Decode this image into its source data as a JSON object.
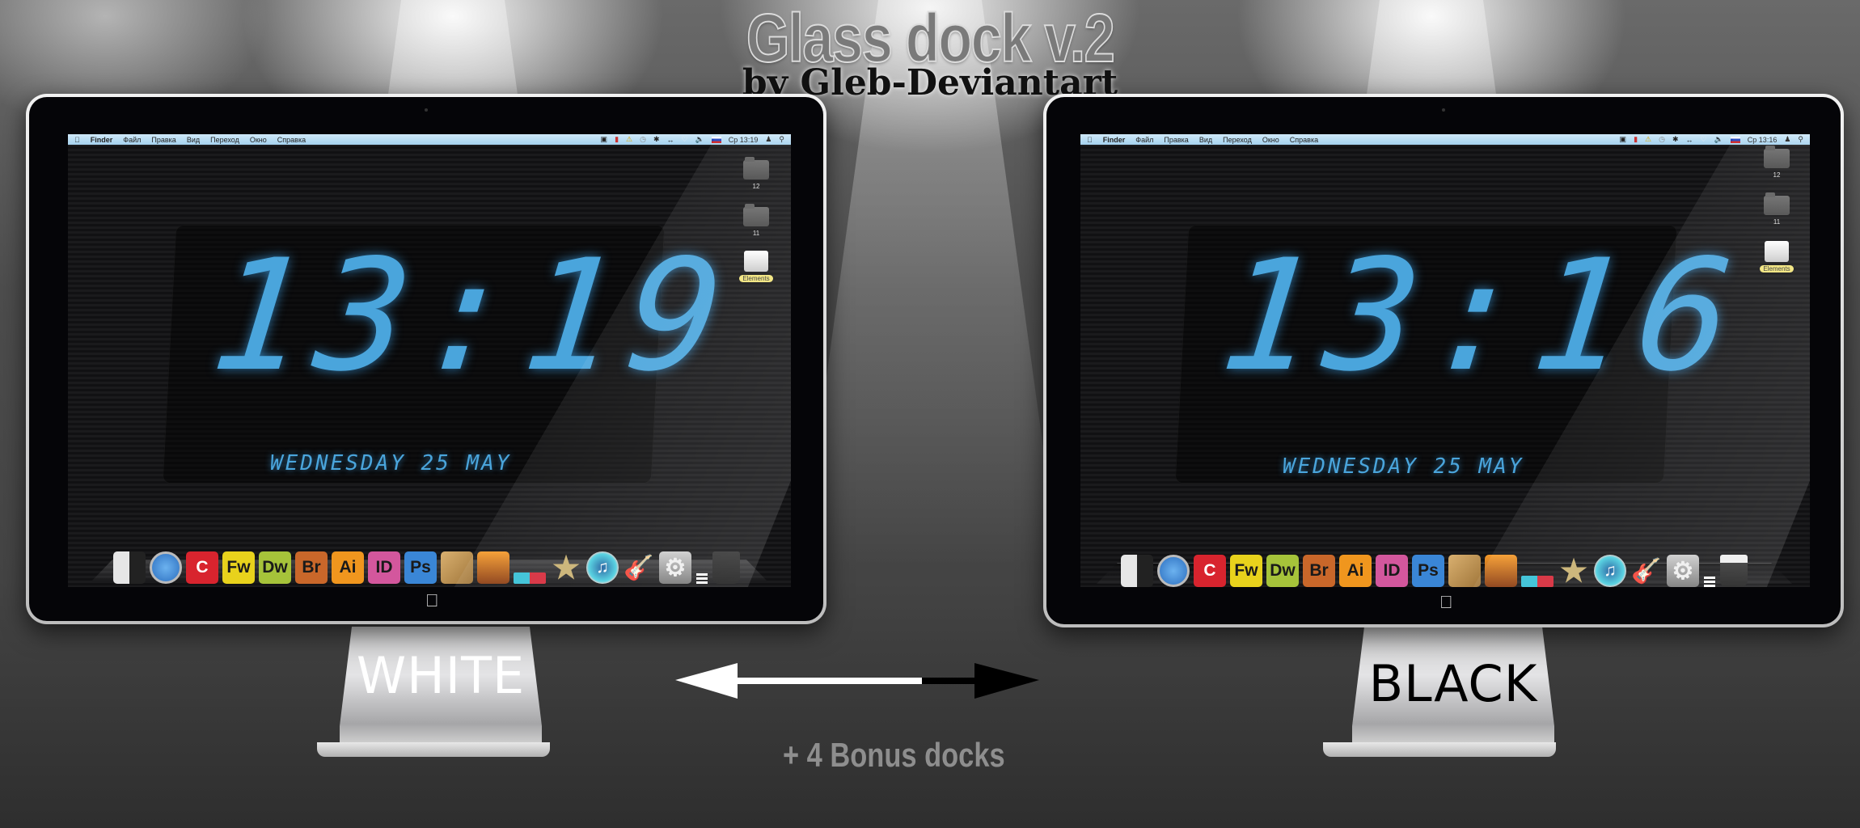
{
  "header": {
    "title": "Glass dock v.2",
    "subtitle": "by Gleb-Deviantart"
  },
  "monitors": [
    {
      "variant_label": "WHITE",
      "menubar": {
        "apple_icon": "apple-icon",
        "items": [
          "Finder",
          "Файл",
          "Правка",
          "Вид",
          "Переход",
          "Окно",
          "Справка"
        ],
        "status_icons": [
          "screen-icon",
          "battery-bars-icon",
          "warning-icon",
          "time-machine-icon",
          "bluetooth-icon",
          "sync-icon",
          "wifi-icon",
          "volume-icon",
          "russian-flag-icon"
        ],
        "clock": "Ср 13:19",
        "user_icon": "user-icon",
        "search_icon": "spotlight-icon"
      },
      "clock_widget": {
        "time": "13:19",
        "date": "WEDNESDAY 25 MAY"
      },
      "desktop_items": [
        {
          "icon": "folder-icon",
          "label": "12"
        },
        {
          "icon": "folder-icon",
          "label": "11"
        },
        {
          "icon": "external-drive-icon",
          "label": "Elements"
        }
      ],
      "dock": [
        "Finder",
        "Safari",
        "Coda",
        "Fw",
        "Dw",
        "Br",
        "Ai",
        "ID",
        "Ps",
        "Pixelmator",
        "iPhoto",
        "3D glasses",
        "iMovie",
        "iTunes",
        "GarageBand",
        "System Preferences",
        "Stack",
        "Trash"
      ],
      "trash_state": "empty"
    },
    {
      "variant_label": "BLACK",
      "menubar": {
        "apple_icon": "apple-icon",
        "items": [
          "Finder",
          "Файл",
          "Правка",
          "Вид",
          "Переход",
          "Окно",
          "Справка"
        ],
        "status_icons": [
          "screen-icon",
          "battery-bars-icon",
          "warning-icon",
          "time-machine-icon",
          "bluetooth-icon",
          "sync-icon",
          "wifi-icon",
          "volume-icon",
          "russian-flag-icon"
        ],
        "clock": "Ср 13:16",
        "user_icon": "user-icon",
        "search_icon": "spotlight-icon"
      },
      "clock_widget": {
        "time": "13:16",
        "date": "WEDNESDAY 25 MAY"
      },
      "desktop_items": [
        {
          "icon": "folder-icon",
          "label": "12"
        },
        {
          "icon": "folder-icon",
          "label": "11"
        },
        {
          "icon": "external-drive-icon",
          "label": "Elements"
        }
      ],
      "dock": [
        "Finder",
        "Safari",
        "Coda",
        "Fw",
        "Dw",
        "Br",
        "Ai",
        "ID",
        "Ps",
        "Pixelmator",
        "iPhoto",
        "3D glasses",
        "iMovie",
        "iTunes",
        "GarageBand",
        "System Preferences",
        "Stack",
        "Trash"
      ],
      "trash_state": "full"
    }
  ],
  "dock_tile_colors": {
    "Fw": "#e8d21c",
    "Dw": "#a6c33a",
    "Br": "#c9672a",
    "Ai": "#f0961e",
    "ID": "#d3579d",
    "Ps": "#3a86d6"
  },
  "accent_colors": {
    "clock_blue": "#4aa5dc",
    "menubar_blue": "#a5d2ef"
  },
  "footer": {
    "bonus_text": "+ 4 Bonus docks",
    "arrow": "double-arrow-white-black"
  }
}
